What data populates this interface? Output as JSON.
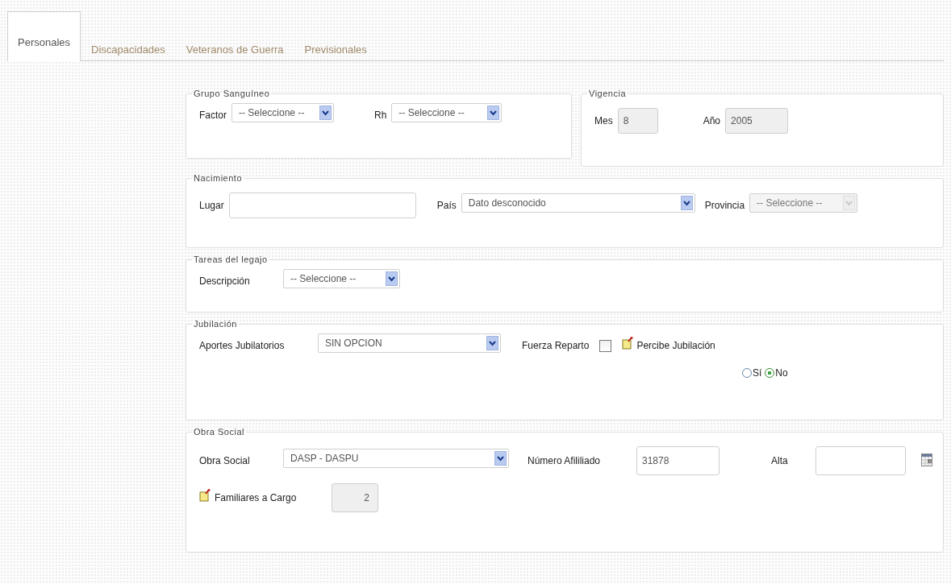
{
  "tabs": [
    {
      "label": "Personales",
      "selected": true
    },
    {
      "label": "Discapacidades",
      "selected": false
    },
    {
      "label": "Veteranos de Guerra",
      "selected": false
    },
    {
      "label": "Previsionales",
      "selected": false
    }
  ],
  "grupo_sanguineo": {
    "legend": "Grupo Sanguíneo",
    "factor": {
      "label": "Factor",
      "value": "-- Seleccione --"
    },
    "rh": {
      "label": "Rh",
      "value": "-- Seleccione --"
    }
  },
  "vigencia": {
    "legend": "Vigencia",
    "mes": {
      "label": "Mes",
      "value": "8",
      "disabled": true
    },
    "anio": {
      "label": "Año",
      "value": "2005",
      "disabled": true
    }
  },
  "nacimiento": {
    "legend": "Nacimiento",
    "lugar": {
      "label": "Lugar"
    },
    "pais": {
      "label": "País",
      "value": "Dato desconocido"
    },
    "provincia": {
      "label": "Provincia",
      "value": "-- Seleccione --",
      "disabled": true
    }
  },
  "tareas": {
    "legend": "Tareas del legajo",
    "descripcion": {
      "label": "Descripción",
      "value": "-- Seleccione --"
    }
  },
  "jubilacion": {
    "legend": "Jubilación",
    "aportes": {
      "label": "Aportes Jubilatorios",
      "value": "SIN OPCION"
    },
    "fuerza_reparto": {
      "label": "Fuerza Reparto",
      "checked": false
    },
    "percibe": {
      "label": "Percibe Jubilación",
      "options": [
        {
          "label": "Sí",
          "selected": false
        },
        {
          "label": "No",
          "selected": true
        }
      ]
    }
  },
  "obra_social": {
    "legend": "Obra Social",
    "obra": {
      "label": "Obra Social",
      "value": "DASP - DASPU"
    },
    "numero": {
      "label": "Número Afililiado",
      "value": "31878"
    },
    "alta": {
      "label": "Alta"
    },
    "familiares": {
      "label": "Familiares a Cargo",
      "value": "2",
      "disabled": true
    }
  }
}
